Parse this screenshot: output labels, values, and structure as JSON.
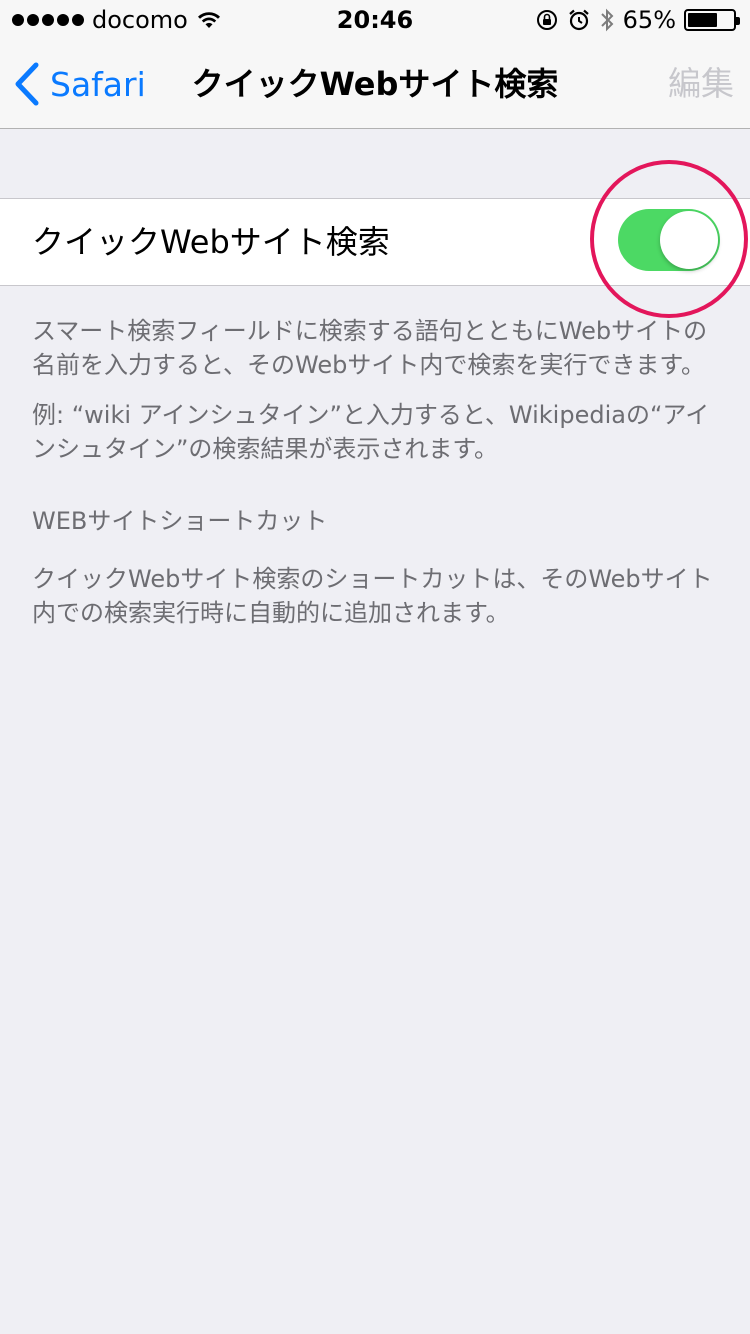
{
  "status_bar": {
    "carrier": "docomo",
    "time": "20:46",
    "battery_percent": "65%",
    "battery_level": 0.65,
    "icons": [
      "signal-dots-icon",
      "wifi-icon",
      "rotation-lock-icon",
      "alarm-icon",
      "bluetooth-icon",
      "battery-icon"
    ]
  },
  "nav": {
    "back_label": "Safari",
    "title": "クイックWebサイト検索",
    "edit_label": "編集"
  },
  "toggle_row": {
    "label": "クイックWebサイト検索",
    "enabled": true,
    "on_color": "#4cd964",
    "highlight_color": "#e3165b"
  },
  "description": {
    "line1": "スマート検索フィールドに検索する語句とともにWebサイトの名前を入力すると、そのWebサイト内で検索を実行できます。",
    "line2": "例: “wiki アインシュタイン”と入力すると、Wikipediaの“アインシュタイン”の検索結果が表示されます。"
  },
  "shortcuts_section": {
    "header": "WEBサイトショートカット",
    "footer": "クイックWebサイト検索のショートカットは、そのWebサイト内での検索実行時に自動的に追加されます。"
  },
  "colors": {
    "accent": "#0a7aff",
    "background": "#efeff4",
    "secondary_text": "#6d6d72",
    "disabled_text": "#c7c7cc"
  }
}
